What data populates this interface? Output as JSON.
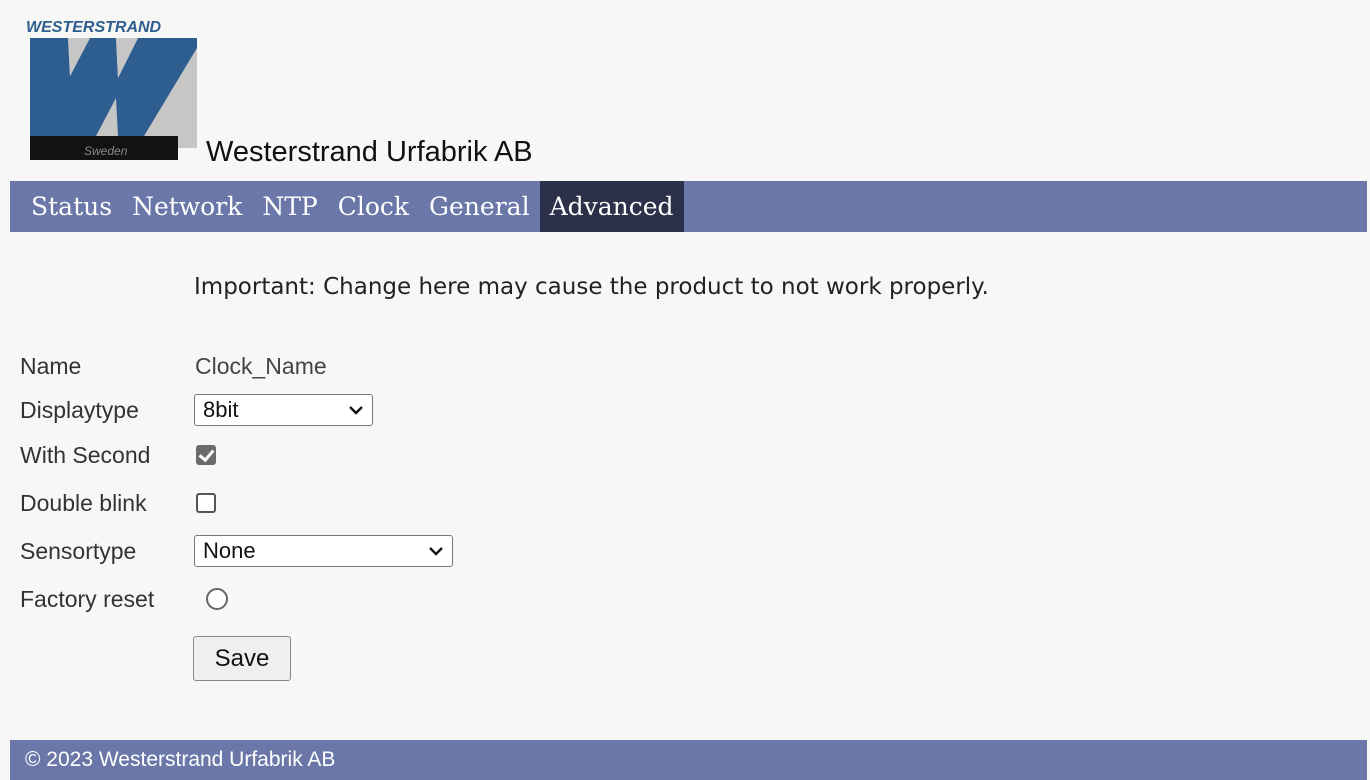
{
  "header": {
    "logo": {
      "brand_text": "WESTERSTRAND",
      "letter": "W",
      "country_text": "Sweden",
      "colors": {
        "blue": "#2e5e8f",
        "gray": "#c6c6c6",
        "black": "#121212"
      }
    },
    "company_name": "Westerstrand Urfabrik AB"
  },
  "nav": {
    "items": [
      {
        "label": "Status"
      },
      {
        "label": "Network"
      },
      {
        "label": "NTP"
      },
      {
        "label": "Clock"
      },
      {
        "label": "General"
      },
      {
        "label": "Advanced"
      }
    ],
    "active": "Advanced",
    "bg_color": "#6a77a8",
    "active_color": "#2c3048"
  },
  "warning": "Important: Change here may cause the product to not work properly.",
  "form": {
    "name": {
      "label": "Name",
      "value": "Clock_Name"
    },
    "displaytype": {
      "label": "Displaytype",
      "selected": "8bit",
      "icon": "chevron-down-icon"
    },
    "with_second": {
      "label": "With Second",
      "checked": true
    },
    "double_blink": {
      "label": "Double blink",
      "checked": false
    },
    "sensortype": {
      "label": "Sensortype",
      "selected": "None",
      "icon": "chevron-down-icon"
    },
    "factory_reset": {
      "label": "Factory reset",
      "selected": false
    },
    "save_label": "Save"
  },
  "footer": {
    "text": "© 2023 Westerstrand Urfabrik AB"
  }
}
